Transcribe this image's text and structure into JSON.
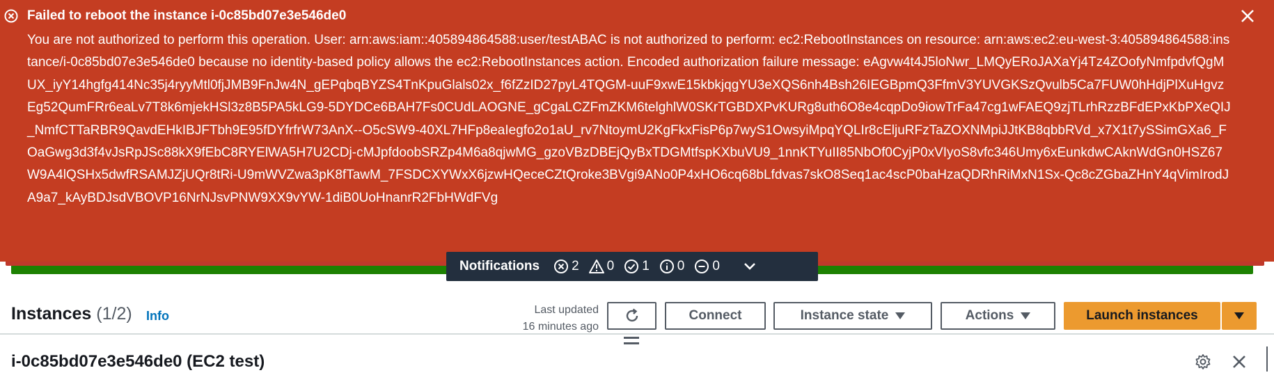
{
  "flash": {
    "title": "Failed to reboot the instance i-0c85bd07e3e546de0",
    "message": "You are not authorized to perform this operation. User: arn:aws:iam::405894864588:user/testABAC is not authorized to perform: ec2:RebootInstances on resource: arn:aws:ec2:eu-west-3:405894864588:instance/i-0c85bd07e3e546de0 because no identity-based policy allows the ec2:RebootInstances action. Encoded authorization failure message: eAgvw4t4J5loNwr_LMQyERoJAXaYj4Tz4ZOofyNmfpdvfQgMUX_iyY14hgfg414Nc35j4ryyMtl0fjJMB9FnJw4N_gEPqbqBYZS4TnKpuGlals02x_f6fZzID27pyL4TQGM-uuF9xwE15kbkjqgYU3eXQS6nh4Bsh26IEGBpmQ3FfmV3YUVGKSzQvulb5Ca7FUW0hHdjPlXuHgvzEg52QumFRr6eaLv7T8k6mjekHSl3z8B5PA5kLG9-5DYDCe6BAH7Fs0CUdLAOGNE_gCgaLCZFmZKM6telghlW0SKrTGBDXPvKURg8uth6O8e4cqpDo9iowTrFa47cg1wFAEQ9zjTLrhRzzBFdEPxKbPXeQIJ_NmfCTTaRBR9QavdEHkIBJFTbh9E95fDYfrfrW73AnX--O5cSW9-40XL7HFp8eaIegfo2o1aU_rv7NtoymU2KgFkxFisP6p7wyS1OwsyiMpqYQLIr8cEljuRFzTaZOXNMpiJJtKB8qbbRVd_x7X1t7ySSimGXa6_FOaGwg3d3f4vJsRpJSc88kX9fEbC8RYElWA5H7U2CDj-cMJpfdoobSRZp4M6a8qjwMG_gzoVBzDBEjQyBxTDGMtfspKXbuVU9_1nnKTYuII85NbOf0CyjP0xVIyoS8vfc346Umy6xEunkdwCAknWdGn0HSZ67W9A4lQSHx5dwfRSAMJZjUQr8tRi-U9mWVZwa3pK8fTawM_7FSDCXYWxX6jzwHQeceCZtQroke3BVgi9ANo0P4xHO6cq68bLfdvas7skO8Seq1ac4scP0baHzaQDRhRiMxN1Sx-Qc8cZGbaZHnY4qVimIrodJA9a7_kAyBDJsdVBOVP16NrNJsvPNW9XX9vYW-1diB0UoHnanrR2FbHWdFVg",
    "colors": {
      "error": "#c43d22",
      "success": "#1d8102"
    }
  },
  "notifications": {
    "title": "Notifications",
    "counts": [
      {
        "icon": "error-icon",
        "value": "2"
      },
      {
        "icon": "warning-icon",
        "value": "0"
      },
      {
        "icon": "success-icon",
        "value": "1"
      },
      {
        "icon": "info-icon",
        "value": "0"
      },
      {
        "icon": "in-progress-icon",
        "value": "0"
      }
    ]
  },
  "instances": {
    "title": "Instances",
    "count": "(1/2)",
    "info": "Info",
    "last_updated_line1": "Last updated",
    "last_updated_line2": "16 minutes ago",
    "buttons": {
      "connect": "Connect",
      "instance_state": "Instance state",
      "actions": "Actions",
      "launch": "Launch instances"
    }
  },
  "detail": {
    "title": "i-0c85bd07e3e546de0 (EC2 test)"
  }
}
